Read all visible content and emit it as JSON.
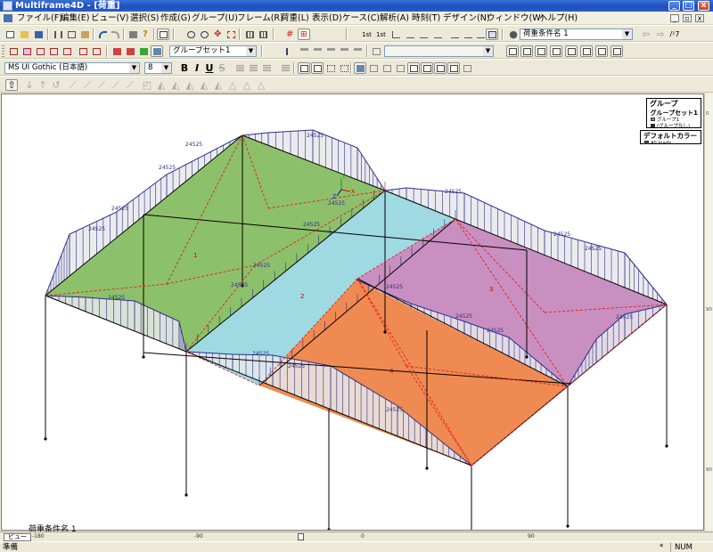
{
  "window": {
    "title": "Multiframe4D - [荷重]",
    "minimize": "_",
    "maximize": "□",
    "close": "x"
  },
  "menu": [
    "ファイル(F)",
    "編集(E)",
    "ビュー(V)",
    "選択(S)",
    "作成(G)",
    "グループ(U)",
    "フレーム(R)",
    "荷重(L)",
    "表示(D)",
    "ケース(C)",
    "解析(A)",
    "時刻(T)",
    "デザイン(N)",
    "ウィンドウ(W)",
    "ヘルプ(H)"
  ],
  "toolbar": {
    "group_set_combo": "グループセット1",
    "load_case_combo": "荷重条件名 1",
    "font_combo": "MS UI Gothic (日本語)",
    "font_size_combo": "8",
    "bold": "B",
    "italic": "I",
    "underline": "U",
    "strike": "S",
    "help_label": "?"
  },
  "legend": {
    "group_title": "グループ",
    "group_set": "グループセット1",
    "groups": [
      {
        "label": "グループ1",
        "color": "#6fb04a"
      },
      {
        "label": "(グループなし)",
        "color": "#1f1f1f"
      }
    ],
    "color_title": "デフォルトカラー",
    "colors": [
      {
        "label": "All loads",
        "color": "#3a3a8c"
      }
    ]
  },
  "model": {
    "load_value": "24525",
    "panel_labels": [
      "1",
      "2",
      "3",
      "4"
    ],
    "colors": {
      "green": "#8dc06a",
      "cyan": "#9fd9e2",
      "magenta": "#c98fc0",
      "orange": "#ef8a52",
      "load": "#2b2f8c",
      "ridge": "#e02020"
    },
    "axis": {
      "x": "X",
      "y": "Y",
      "z": "Z"
    }
  },
  "canvas": {
    "case_label": "荷重条件名 1",
    "side_ticks": [
      "0",
      "90",
      "90"
    ]
  },
  "ruler": {
    "tab": "ビュー",
    "ticks": [
      "-180",
      "-90",
      "0",
      "90"
    ]
  },
  "status": {
    "ready": "準備",
    "star": "*",
    "num": "NUM"
  }
}
